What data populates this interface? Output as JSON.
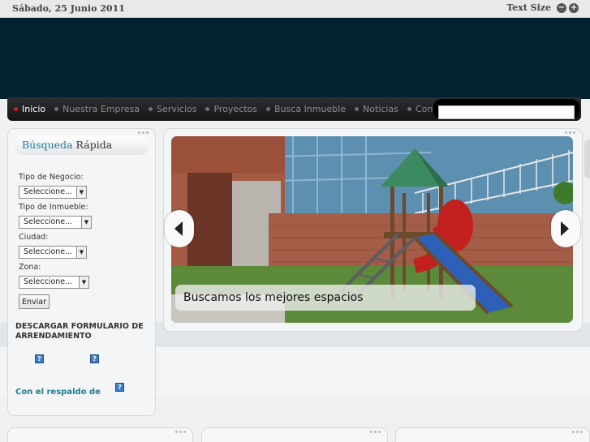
{
  "topbar": {
    "date": "Sábado, 25 Junio 2011",
    "text_size_label": "Text Size",
    "decrease": "−",
    "increase": "+"
  },
  "nav": {
    "items": [
      {
        "label": "Inicio",
        "active": true
      },
      {
        "label": "Nuestra Empresa"
      },
      {
        "label": "Servicios"
      },
      {
        "label": "Proyectos"
      },
      {
        "label": "Busca Inmueble"
      },
      {
        "label": "Noticias"
      },
      {
        "label": "Contacto"
      }
    ],
    "search_value": ""
  },
  "quick_search": {
    "title_highlight": "Búsqueda",
    "title_rest": "Rápida",
    "fields": [
      {
        "label": "Tipo de Negocio:",
        "value": "Seleccione..."
      },
      {
        "label": "Tipo de Inmueble:",
        "value": "Seleccione..."
      },
      {
        "label": "Ciudad:",
        "value": "Seleccione..."
      },
      {
        "label": "Zona:",
        "value": "Seleccione..."
      }
    ],
    "submit_label": "Enviar",
    "download_text": "DESCARGAR  FORMULARIO DE ARRENDAMIENTO",
    "support_text": "Con el respaldo de",
    "broken_image_glyph": "?"
  },
  "slider": {
    "caption": "Buscamos los mejores espacios"
  },
  "colors": {
    "header": "#042130",
    "accent": "#1f79a0",
    "nav_active_dot": "#d01d1d"
  }
}
